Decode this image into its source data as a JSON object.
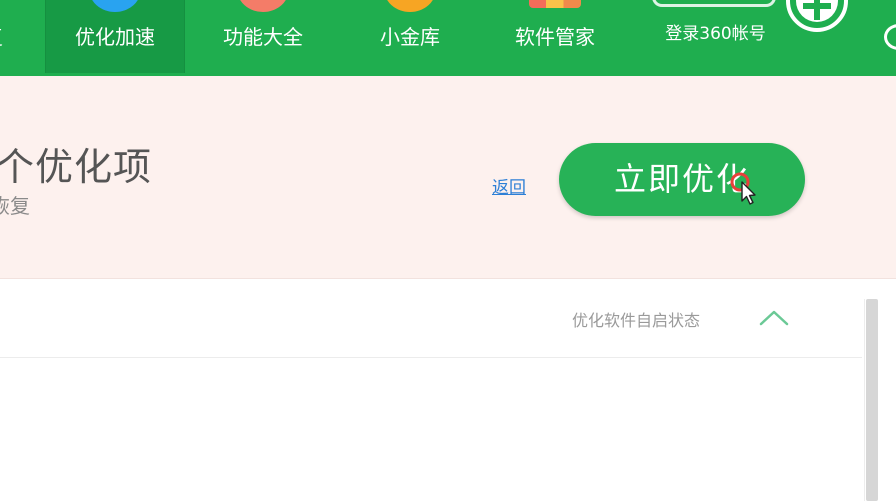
{
  "nav": {
    "items": [
      {
        "label": "复",
        "icon": "repair-icon"
      },
      {
        "label": "优化加速",
        "icon": "speedup-icon"
      },
      {
        "label": "功能大全",
        "icon": "features-icon"
      },
      {
        "label": "小金库",
        "icon": "vault-icon"
      },
      {
        "label": "软件管家",
        "icon": "software-manager-icon"
      }
    ],
    "login_label": "登录360帐号"
  },
  "summary": {
    "title": "个优化项",
    "subtitle": "恢复",
    "back_label": "返回",
    "optimize_label": "立即优化"
  },
  "list": {
    "header_label": "优化软件自启状态"
  },
  "colors": {
    "nav_green": "#1fae4f",
    "nav_active": "#179a45",
    "summary_bg": "#fdf1ee",
    "button_green": "#27b257",
    "link_blue": "#2d7fd6"
  }
}
